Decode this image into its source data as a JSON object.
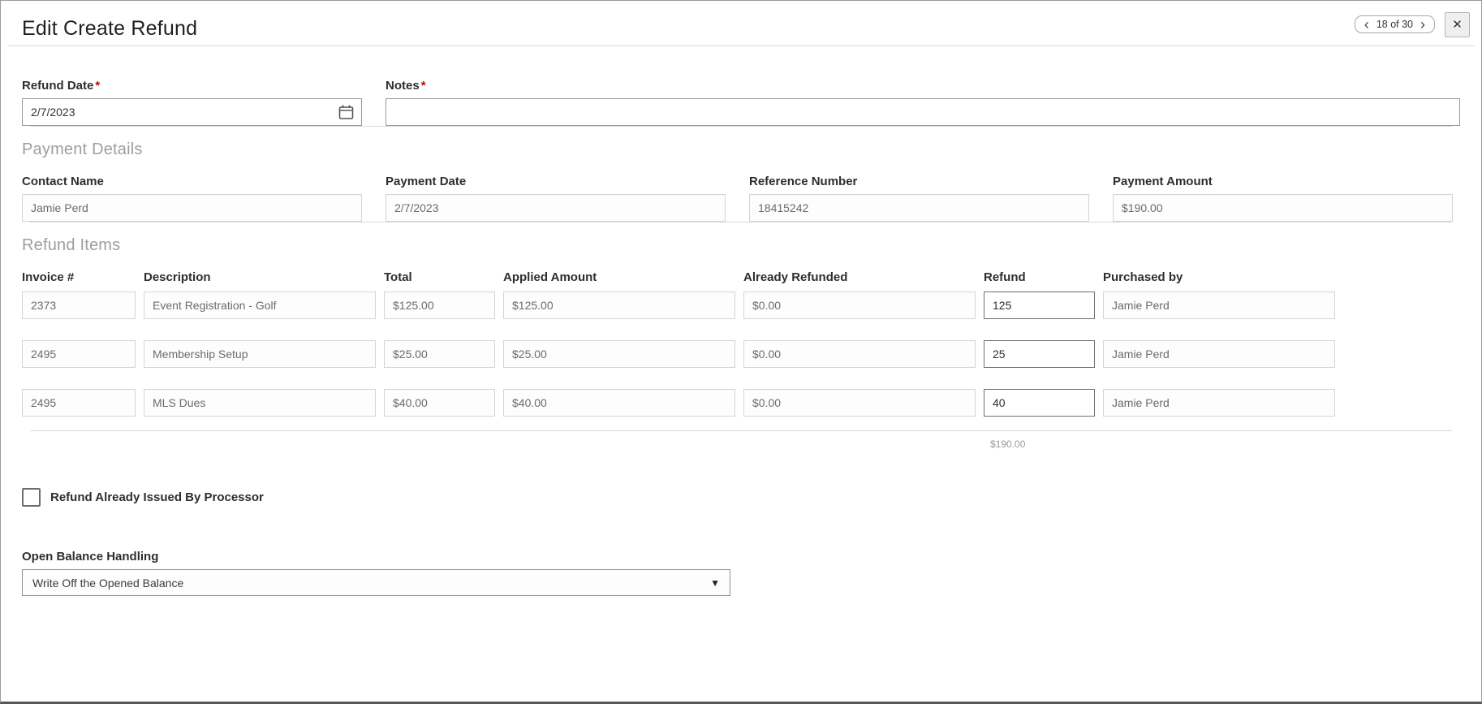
{
  "header": {
    "title": "Edit Create Refund",
    "pagination": {
      "prev_icon": "‹",
      "current": "18 of 30",
      "next_icon": "›"
    },
    "close_icon": "✕"
  },
  "form": {
    "refund_date": {
      "label": "Refund Date",
      "required": "*",
      "value": "2/7/2023"
    },
    "notes": {
      "label": "Notes",
      "required": "*",
      "value": ""
    }
  },
  "payment_details": {
    "heading": "Payment Details",
    "fields": [
      {
        "label": "Contact Name",
        "value": "Jamie Perd"
      },
      {
        "label": "Payment Date",
        "value": "2/7/2023"
      },
      {
        "label": "Reference Number",
        "value": "18415242"
      },
      {
        "label": "Payment Amount",
        "value": "$190.00"
      }
    ]
  },
  "refund_items": {
    "heading": "Refund Items",
    "columns": [
      "Invoice #",
      "Description",
      "Total",
      "Applied Amount",
      "Already Refunded",
      "Refund",
      "Purchased by"
    ],
    "rows": [
      {
        "invoice": "2373",
        "description": "Event Registration - Golf",
        "total": "$125.00",
        "applied": "$125.00",
        "already_refunded": "$0.00",
        "refund": "125",
        "purchased_by": "Jamie Perd"
      },
      {
        "invoice": "2495",
        "description": "Membership Setup",
        "total": "$25.00",
        "applied": "$25.00",
        "already_refunded": "$0.00",
        "refund": "25",
        "purchased_by": "Jamie Perd"
      },
      {
        "invoice": "2495",
        "description": "MLS Dues",
        "total": "$40.00",
        "applied": "$40.00",
        "already_refunded": "$0.00",
        "refund": "40",
        "purchased_by": "Jamie Perd"
      }
    ],
    "refund_total": "$190.00"
  },
  "options": {
    "processor_checkbox_label": "Refund Already Issued By Processor",
    "open_balance": {
      "label": "Open Balance Handling",
      "selected": "Write Off the Opened Balance",
      "caret_icon": "▼"
    }
  }
}
